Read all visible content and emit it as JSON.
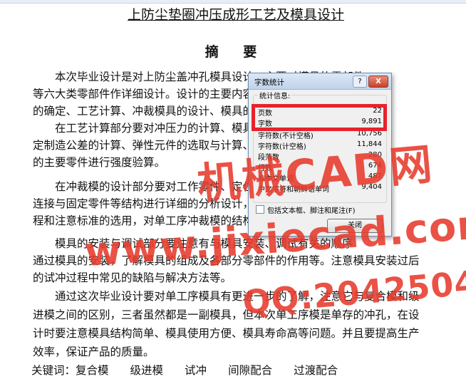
{
  "document": {
    "title": "上防尘垫圈冲压成形工艺及模具设计",
    "abstract_heading": "摘 要",
    "lines": [
      "本次毕业设计是对上防尘盖冲孔模具设计，主要对模具的零部件",
      "等六大类零部件作详细设计。设计的主要内容包括：冲压件的工艺方案",
      "的确定、工艺计算、冲裁模具的设计、模具的主要零件设计等。",
      "在工艺计算部分要对冲压力的计算、模具刃口尺寸计算、尺寸并确",
      "定制造公差的计算、弹性元件的选取与计算、模具的主要零件、要对模具",
      "的主要零件进行强度验算。",
      "在冲裁模的设计部分要对工作零件、定位零件、卸料零件、导向零件",
      "连接与固定零件等结构进行详细的分析设计，并确定它们的工作过",
      "程和注意标准的选用，对单工序冲裁模的结构有所了解。",
      "模具的安装与调试部分要注意有与模具安装、调试有关的顺序",
      "通过模具的安装，了解模具的组成及各部分零部件的作用等。注意模具安装过后",
      "的试冲过程中常见的缺陷与解决方法等。",
      "通过这次毕业设计要对单工序模具有更进一步的了解，注意它与复合模和级",
      "进模之间的区别，三者虽然都是一副模具，但本次单工序模是单存的冲孔，在设",
      "计时要注意模具结构简单、模具使用方便、模具寿命高等问题。并且要提高生产",
      "效率，保证产品的质量。"
    ],
    "keywords_label": "关键词：",
    "keywords": [
      "复合模",
      "级进模",
      "试冲",
      "间隙配合",
      "过渡配合"
    ]
  },
  "dialog": {
    "title": "字数统计",
    "help": "?",
    "close_x": "X",
    "group_label": "统计信息:",
    "stats": [
      {
        "label": "页数",
        "value": "22"
      },
      {
        "label": "字数",
        "value": "9,891"
      },
      {
        "label": "字符数(不计空格)",
        "value": "10,756"
      },
      {
        "label": "字符数(计空格)",
        "value": "11,844"
      },
      {
        "label": "段落数",
        "value": "280"
      },
      {
        "label": "行数",
        "value": "674"
      },
      {
        "label": "非中文单词",
        "value": "487"
      },
      {
        "label": "中文字符和朝鲜语单词",
        "value": "9,404"
      }
    ],
    "checkbox_label": "包括文本框、脚注和尾注(F)",
    "close_button": "关闭"
  },
  "watermark": {
    "line1": "机械CAD网",
    "line2": "www.jixiecad.com",
    "line3": "QQ:20425042"
  },
  "colors": {
    "highlight": "#e8212b",
    "watermark": "#e73b2c"
  }
}
